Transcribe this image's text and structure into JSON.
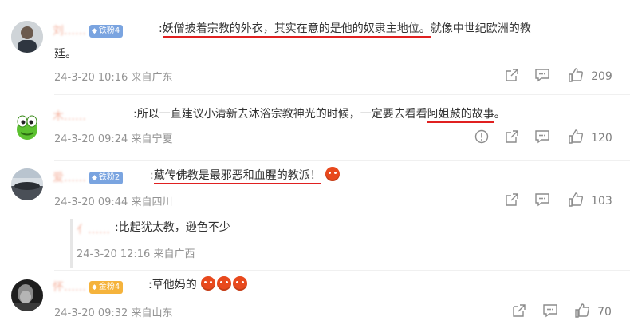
{
  "comments": [
    {
      "name": "刘……",
      "badge": "铁粉4",
      "text_pre": ":",
      "text_hl1": "妖僧披着宗教的外衣，其实在意的是他的奴隶主地位。",
      "text_post": "就像中世纪欧洲的教",
      "text_line2": "廷。",
      "time": "24-3-20 10:16 来自广东",
      "likes": "209"
    },
    {
      "name": "木……",
      "text_pre": ":所以一直建议小清新去沐浴宗教神光的时候，一定要去看看",
      "text_hl1": "阿姐鼓的故事",
      "text_post": "。",
      "time": "24-3-20 09:24 来自宁夏",
      "likes": "120"
    },
    {
      "name": "爱……",
      "badge": "铁粉2",
      "text_pre": ":",
      "text_hl1": "藏传佛教是最邪恶和血腥的教派！",
      "time": "24-3-20 09:44 来自四川",
      "likes": "103",
      "reply": {
        "name": "亻……",
        "text": ":比起犹太教，逊色不少",
        "time": "24-3-20 12:16 来自广西"
      }
    },
    {
      "name": "怀……",
      "badge": "金粉4",
      "text_pre": ":草他妈的",
      "time": "24-3-20 09:32 来自山东",
      "likes": "70"
    }
  ],
  "colors": {
    "name": "#eb7350",
    "underline": "#e02020",
    "meta": "#939393"
  },
  "icons": [
    "share-icon",
    "comment-icon",
    "like-icon",
    "report-icon",
    "angry-emoji"
  ]
}
